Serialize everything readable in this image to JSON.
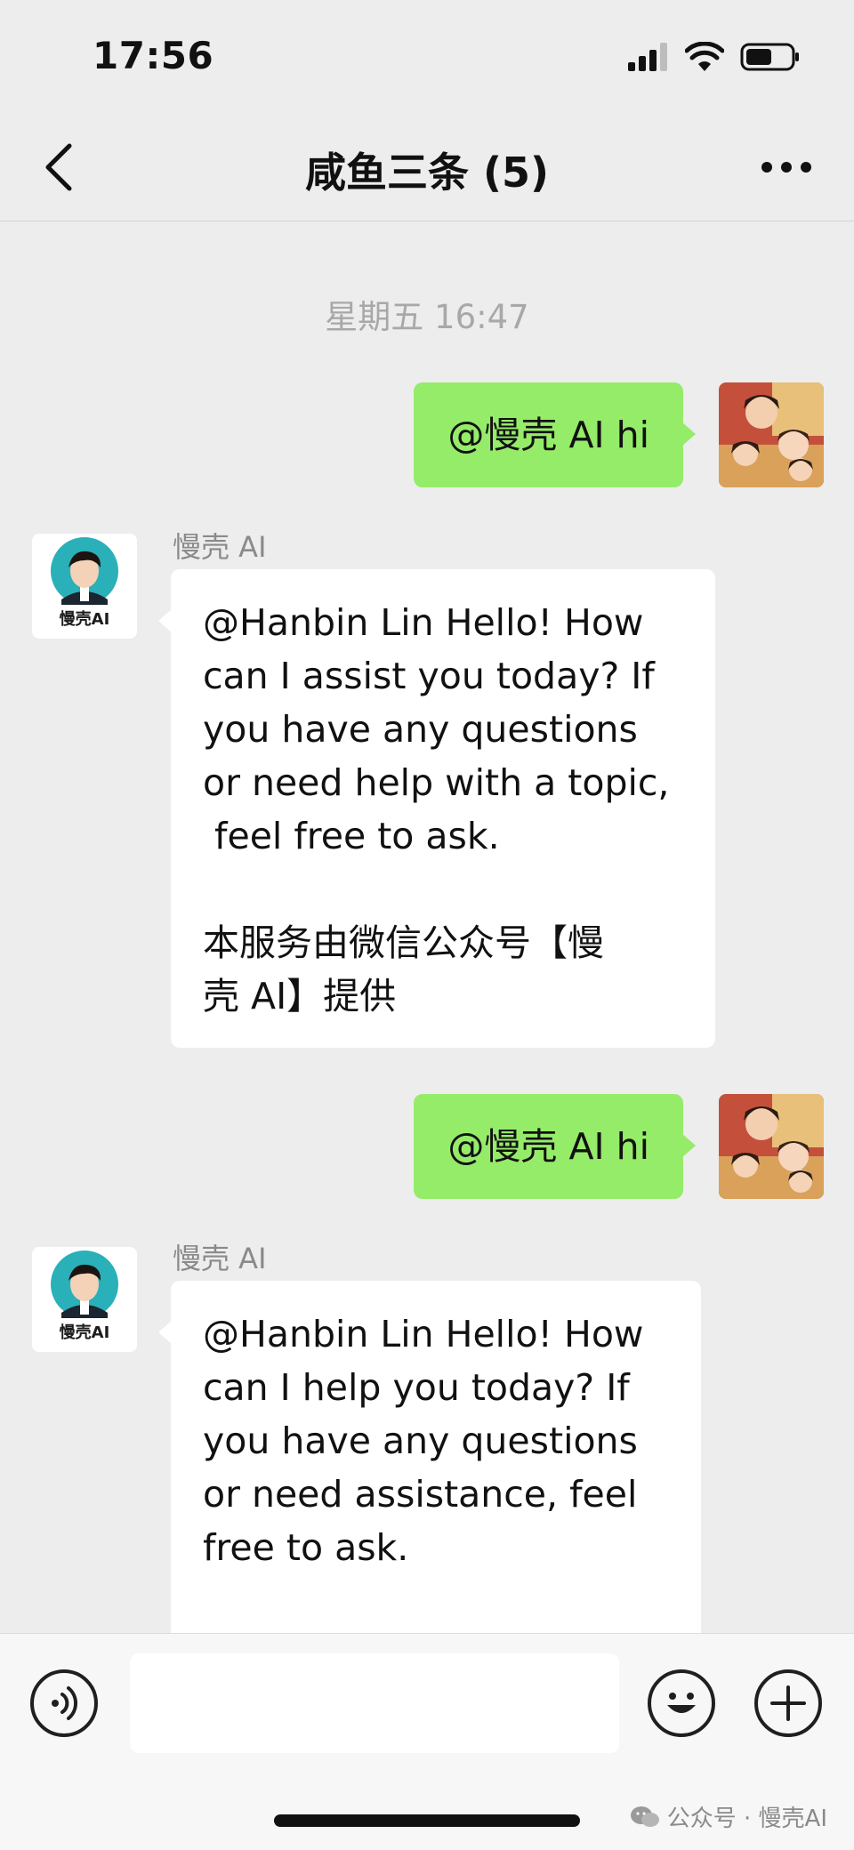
{
  "status": {
    "time": "17:56"
  },
  "nav": {
    "title": "咸鱼三条 (5)"
  },
  "chat": {
    "timestamp": "星期五 16:47",
    "messages": [
      {
        "from": "me",
        "text": "@慢壳 AI hi"
      },
      {
        "from": "bot",
        "sender": "慢壳 AI",
        "text": "@Hanbin Lin Hello! How\ncan I assist you today? If\nyou have any questions\nor need help with a topic,\n feel free to ask.\n\n本服务由微信公众号【慢\n壳 AI】提供"
      },
      {
        "from": "me",
        "text": "@慢壳 AI hi"
      },
      {
        "from": "bot",
        "sender": "慢壳 AI",
        "text": "@Hanbin Lin Hello! How\ncan I help you today? If\nyou have any questions\nor need assistance, feel\nfree to ask."
      }
    ],
    "bot_avatar_label": "慢壳AI"
  },
  "input": {
    "value": ""
  },
  "watermark": {
    "text": "公众号 · 慢壳AI"
  },
  "colors": {
    "outgoing_bubble": "#95ec69",
    "incoming_bubble": "#ffffff",
    "background": "#ededed"
  },
  "icons": [
    "back-chevron-icon",
    "more-dots-icon",
    "voice-icon",
    "emoji-icon",
    "plus-icon",
    "wechat-icon"
  ]
}
